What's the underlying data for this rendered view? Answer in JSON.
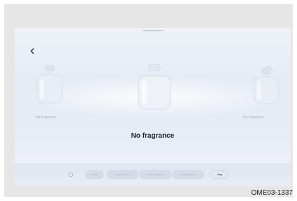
{
  "screen": {
    "center_label": "No fragrance",
    "left_label": "No fragrance",
    "right_label": "No fragrance"
  },
  "controls": {
    "off_label": "Disable",
    "light_label": "Light fragrance",
    "delicate_label": "Delicate fragrance",
    "strong_label": "Strong fragrance",
    "more_label": "Img"
  },
  "icons": {
    "back": "back-chevron-icon",
    "power": "power-icon"
  },
  "figure_code": "OME03-1337"
}
